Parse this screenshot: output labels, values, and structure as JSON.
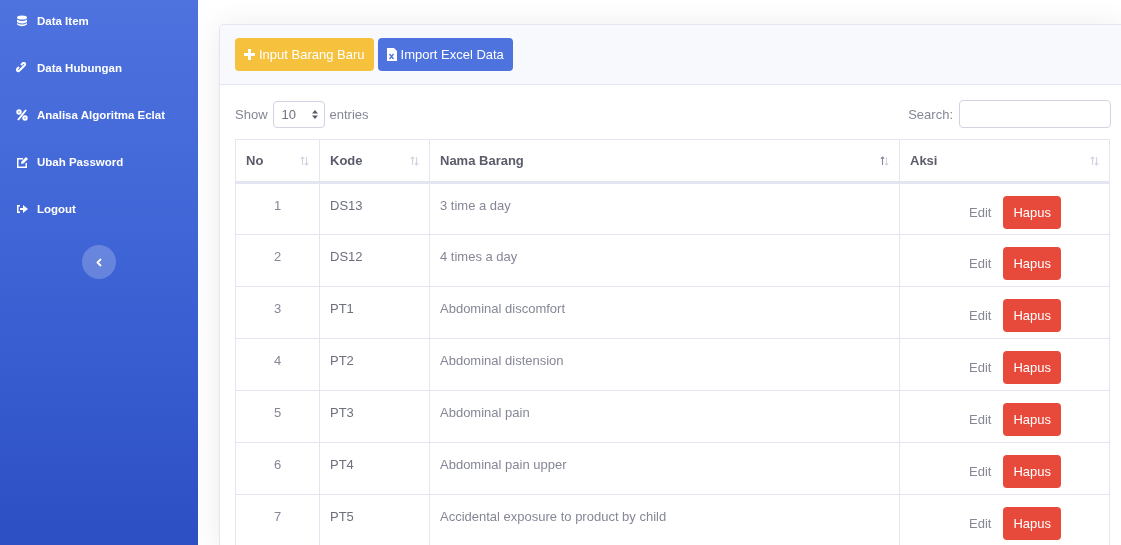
{
  "sidebar": {
    "items": [
      {
        "label": "Data Item",
        "kind": "database"
      },
      {
        "label": "Data Hubungan",
        "kind": "link"
      },
      {
        "label": "Analisa Algoritma Eclat",
        "kind": "percent"
      },
      {
        "label": "Ubah Password",
        "kind": "edit"
      },
      {
        "label": "Logout",
        "kind": "logout"
      }
    ]
  },
  "card": {
    "buttons": [
      {
        "label": "Input Barang Baru",
        "kind": "plus"
      },
      {
        "label": "Import Excel Data",
        "kind": "excel"
      }
    ],
    "length": {
      "before": "Show",
      "value": "10",
      "after": "entries"
    },
    "search": {
      "label": "Search:"
    },
    "table": {
      "columns": [
        {
          "label": "No",
          "sorted": false
        },
        {
          "label": "Kode",
          "sorted": false
        },
        {
          "label": "Nama Barang",
          "sorted": true
        },
        {
          "label": "Aksi",
          "sorted": false
        }
      ],
      "rows": [
        {
          "no": "1",
          "kode": "DS13",
          "nama": "3 time a day",
          "edit": "Edit",
          "delete": "Hapus"
        },
        {
          "no": "2",
          "kode": "DS12",
          "nama": "4 times a day",
          "edit": "Edit",
          "delete": "Hapus"
        },
        {
          "no": "3",
          "kode": "PT1",
          "nama": "Abdominal discomfort",
          "edit": "Edit",
          "delete": "Hapus"
        },
        {
          "no": "4",
          "kode": "PT2",
          "nama": "Abdominal distension",
          "edit": "Edit",
          "delete": "Hapus"
        },
        {
          "no": "5",
          "kode": "PT3",
          "nama": "Abdominal pain",
          "edit": "Edit",
          "delete": "Hapus"
        },
        {
          "no": "6",
          "kode": "PT4",
          "nama": "Abdominal pain upper",
          "edit": "Edit",
          "delete": "Hapus"
        },
        {
          "no": "7",
          "kode": "PT5",
          "nama": "Accidental exposure to product by child",
          "edit": "Edit",
          "delete": "Hapus"
        }
      ]
    }
  }
}
